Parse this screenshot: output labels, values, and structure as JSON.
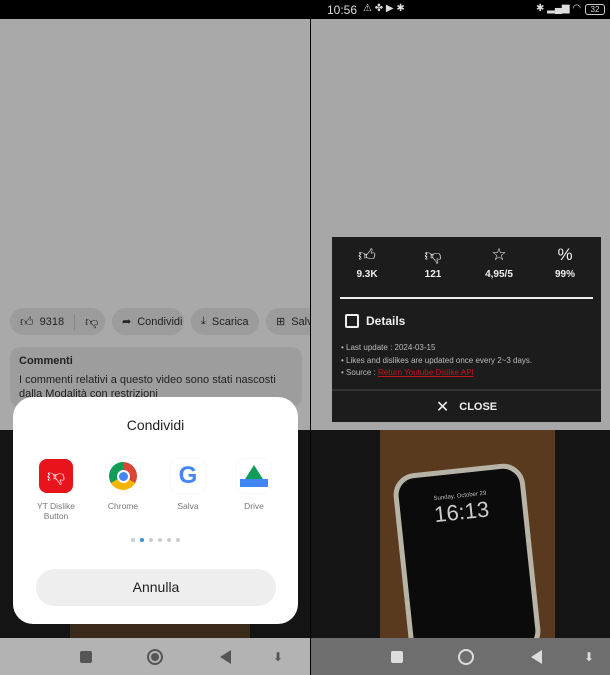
{
  "left": {
    "actions": {
      "like_count": "9318",
      "share": "Condividi",
      "download": "Scarica",
      "save": "Salva"
    },
    "comments": {
      "title": "Commenti",
      "text": "I commenti relativi a questo video sono stati nascosti dalla Modalità con restrizioni"
    },
    "share_sheet": {
      "title": "Condividi",
      "apps": [
        {
          "label": "YT Dislike Button",
          "icon": "thumb-down-icon"
        },
        {
          "label": "Chrome",
          "icon": "chrome-icon"
        },
        {
          "label": "Salva",
          "icon": "google-icon"
        },
        {
          "label": "Drive",
          "icon": "drive-icon"
        }
      ],
      "page_count": 6,
      "active_page": 2,
      "cancel": "Annulla"
    }
  },
  "right": {
    "status": {
      "time": "10:56",
      "battery": "32"
    },
    "popup": {
      "stats": [
        {
          "icon": "thumb-up-icon",
          "value": "9.3K"
        },
        {
          "icon": "thumb-down-icon",
          "value": "121"
        },
        {
          "icon": "star-icon",
          "value": "4,95/5"
        },
        {
          "icon": "percent-icon",
          "value": "99%"
        }
      ],
      "details_label": "Details",
      "details": {
        "last_update_label": "Last update : ",
        "last_update": "2024-03-15",
        "note": "Likes and dislikes are updated once every 2~3 days.",
        "source_label": "Source : ",
        "source_link": "Return Youtube Dislike API"
      },
      "close": "CLOSE"
    },
    "video": {
      "lock_date": "Sunday, October 29",
      "lock_time": "16:13"
    }
  },
  "colors": {
    "accent_red": "#e8131b",
    "link_red": "#c0161c",
    "popup_bg": "#1c1c1c"
  }
}
